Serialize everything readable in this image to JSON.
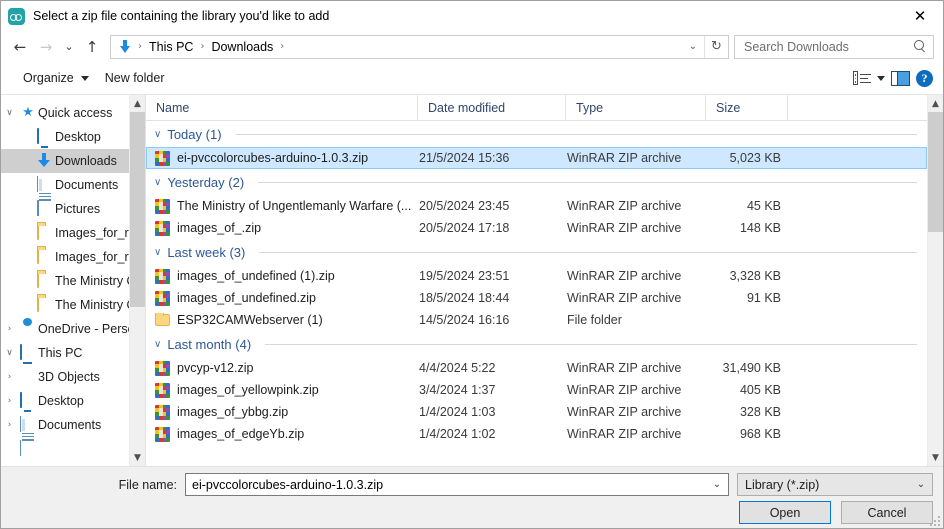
{
  "window": {
    "title": "Select a zip file containing the library you'd like to add",
    "app_icon": "arduino-icon",
    "close_label": "✕"
  },
  "nav": {
    "back": "←",
    "forward": "→",
    "recent": "⌄",
    "up": "↑",
    "breadcrumb": [
      "This PC",
      "Downloads"
    ],
    "separator": "›",
    "dropdown": "⌄",
    "refresh": "↻",
    "search_placeholder": "Search Downloads"
  },
  "toolbar": {
    "organize": "Organize",
    "new_folder": "New folder",
    "view_icon": "view-layout-icon",
    "view_caret": "▾",
    "preview_pane_icon": "preview-pane-icon",
    "help": "?"
  },
  "sidebar": {
    "items": [
      {
        "label": "Quick access",
        "icon": "star-icon",
        "chev": "∨",
        "indent": 1,
        "pin": false,
        "selected": false
      },
      {
        "label": "Desktop",
        "icon": "monitor-icon",
        "chev": "",
        "indent": 2,
        "pin": true,
        "selected": false
      },
      {
        "label": "Downloads",
        "icon": "download-icon",
        "chev": "",
        "indent": 2,
        "pin": true,
        "selected": true
      },
      {
        "label": "Documents",
        "icon": "document-icon",
        "chev": "",
        "indent": 2,
        "pin": true,
        "selected": false
      },
      {
        "label": "Pictures",
        "icon": "picture-icon",
        "chev": "",
        "indent": 2,
        "pin": true,
        "selected": false
      },
      {
        "label": "Images_for_read",
        "icon": "folder-icon",
        "chev": "",
        "indent": 2,
        "pin": false,
        "selected": false
      },
      {
        "label": "Images_for_read",
        "icon": "folder-icon",
        "chev": "",
        "indent": 2,
        "pin": false,
        "selected": false
      },
      {
        "label": "The Ministry Of",
        "icon": "folder-icon",
        "chev": "",
        "indent": 2,
        "pin": false,
        "selected": false
      },
      {
        "label": "The Ministry Of",
        "icon": "folder-icon",
        "chev": "",
        "indent": 2,
        "pin": false,
        "selected": false
      },
      {
        "label": "OneDrive - Personal",
        "icon": "cloud-icon",
        "chev": "›",
        "indent": 1,
        "pin": false,
        "selected": false
      },
      {
        "label": "This PC",
        "icon": "pc-icon",
        "chev": "∨",
        "indent": 1,
        "pin": false,
        "selected": false
      },
      {
        "label": "3D Objects",
        "icon": "cube-icon",
        "chev": "›",
        "indent": 3,
        "pin": false,
        "selected": false
      },
      {
        "label": "Desktop",
        "icon": "monitor-icon",
        "chev": "›",
        "indent": 3,
        "pin": false,
        "selected": false
      },
      {
        "label": "Documents",
        "icon": "document-icon",
        "chev": "›",
        "indent": 3,
        "pin": false,
        "selected": false
      }
    ]
  },
  "filelist": {
    "columns": {
      "name": "Name",
      "date": "Date modified",
      "type": "Type",
      "size": "Size"
    },
    "sort_indicator": "⌄",
    "groups": [
      {
        "label": "Today (1)",
        "chev": "∨",
        "rows": [
          {
            "name": "ei-pvccolorcubes-arduino-1.0.3.zip",
            "date": "21/5/2024 15:36",
            "type": "WinRAR ZIP archive",
            "size": "5,023 KB",
            "icon": "winrar-zip-icon",
            "selected": true
          }
        ]
      },
      {
        "label": "Yesterday (2)",
        "chev": "∨",
        "rows": [
          {
            "name": "The Ministry of Ungentlemanly Warfare (...",
            "date": "20/5/2024 23:45",
            "type": "WinRAR ZIP archive",
            "size": "45 KB",
            "icon": "winrar-zip-icon",
            "selected": false
          },
          {
            "name": "images_of_.zip",
            "date": "20/5/2024 17:18",
            "type": "WinRAR ZIP archive",
            "size": "148 KB",
            "icon": "winrar-zip-icon",
            "selected": false
          }
        ]
      },
      {
        "label": "Last week (3)",
        "chev": "∨",
        "rows": [
          {
            "name": "images_of_undefined (1).zip",
            "date": "19/5/2024 23:51",
            "type": "WinRAR ZIP archive",
            "size": "3,328 KB",
            "icon": "winrar-zip-icon",
            "selected": false
          },
          {
            "name": "images_of_undefined.zip",
            "date": "18/5/2024 18:44",
            "type": "WinRAR ZIP archive",
            "size": "91 KB",
            "icon": "winrar-zip-icon",
            "selected": false
          },
          {
            "name": "ESP32CAMWebserver (1)",
            "date": "14/5/2024 16:16",
            "type": "File folder",
            "size": "",
            "icon": "folder-icon",
            "selected": false
          }
        ]
      },
      {
        "label": "Last month (4)",
        "chev": "∨",
        "rows": [
          {
            "name": "pvcyp-v12.zip",
            "date": "4/4/2024 5:22",
            "type": "WinRAR ZIP archive",
            "size": "31,490 KB",
            "icon": "winrar-zip-icon",
            "selected": false
          },
          {
            "name": "images_of_yellowpink.zip",
            "date": "3/4/2024 1:37",
            "type": "WinRAR ZIP archive",
            "size": "405 KB",
            "icon": "winrar-zip-icon",
            "selected": false
          },
          {
            "name": "images_of_ybbg.zip",
            "date": "1/4/2024 1:03",
            "type": "WinRAR ZIP archive",
            "size": "328 KB",
            "icon": "winrar-zip-icon",
            "selected": false
          },
          {
            "name": "images_of_edgeYb.zip",
            "date": "1/4/2024 1:02",
            "type": "WinRAR ZIP archive",
            "size": "968 KB",
            "icon": "winrar-zip-icon",
            "selected": false
          }
        ]
      }
    ]
  },
  "footer": {
    "filename_label": "File name:",
    "filename_value": "ei-pvccolorcubes-arduino-1.0.3.zip",
    "filetype_value": "Library (*.zip)",
    "open_label": "Open",
    "cancel_label": "Cancel",
    "caret": "⌄"
  },
  "colors": {
    "selection_fill": "#cde8ff",
    "selection_border": "#8ec9f5",
    "group_header_text": "#2b5797",
    "accent_blue": "#0078d7",
    "sidebar_selected": "#cfcfcf"
  }
}
